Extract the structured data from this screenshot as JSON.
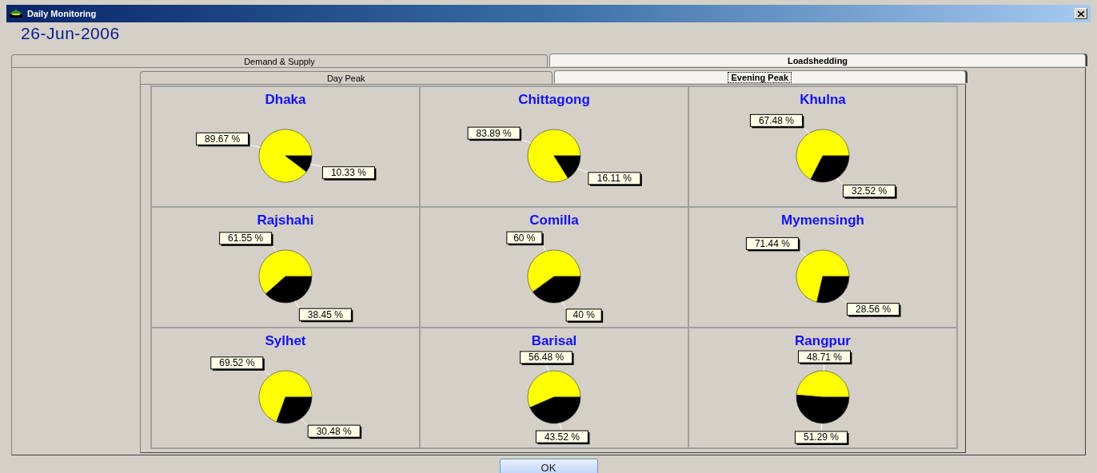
{
  "window": {
    "title": "Daily Monitoring"
  },
  "date": "26-Jun-2006",
  "tabs": [
    {
      "label": "Demand & Supply",
      "selected": false
    },
    {
      "label": "Loadshedding",
      "selected": true
    }
  ],
  "subtabs": [
    {
      "label": "Day Peak",
      "selected": false
    },
    {
      "label": "Evening Peak",
      "selected": true
    }
  ],
  "regions": [
    {
      "name": "Dhaka",
      "chart_data": {
        "type": "pie",
        "values": [
          89.67,
          10.33
        ],
        "value_labels": [
          "89.67 %",
          "10.33 %"
        ]
      }
    },
    {
      "name": "Chittagong",
      "chart_data": {
        "type": "pie",
        "values": [
          83.89,
          16.11
        ],
        "value_labels": [
          "83.89 %",
          "16.11 %"
        ]
      }
    },
    {
      "name": "Khulna",
      "chart_data": {
        "type": "pie",
        "values": [
          67.48,
          32.52
        ],
        "value_labels": [
          "67.48 %",
          "32.52 %"
        ]
      }
    },
    {
      "name": "Rajshahi",
      "chart_data": {
        "type": "pie",
        "values": [
          61.55,
          38.45
        ],
        "value_labels": [
          "61.55 %",
          "38.45 %"
        ]
      }
    },
    {
      "name": "Comilla",
      "chart_data": {
        "type": "pie",
        "values": [
          60,
          40
        ],
        "value_labels": [
          "60 %",
          "40 %"
        ]
      }
    },
    {
      "name": "Mymensingh",
      "chart_data": {
        "type": "pie",
        "values": [
          71.44,
          28.56
        ],
        "value_labels": [
          "71.44 %",
          "28.56 %"
        ]
      }
    },
    {
      "name": "Sylhet",
      "chart_data": {
        "type": "pie",
        "values": [
          69.52,
          30.48
        ],
        "value_labels": [
          "69.52 %",
          "30.48 %"
        ]
      }
    },
    {
      "name": "Barisal",
      "chart_data": {
        "type": "pie",
        "values": [
          56.48,
          43.52
        ],
        "value_labels": [
          "56.48 %",
          "43.52 %"
        ]
      }
    },
    {
      "name": "Rangpur",
      "chart_data": {
        "type": "pie",
        "values": [
          48.71,
          51.29
        ],
        "value_labels": [
          "48.71 %",
          "51.29 %"
        ]
      }
    }
  ],
  "buttons": [
    {
      "label": "OK"
    }
  ]
}
